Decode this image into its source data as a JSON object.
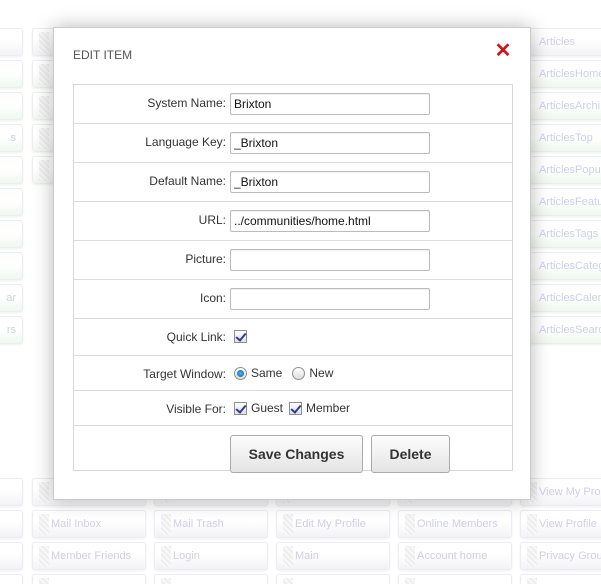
{
  "background": {
    "left_fragments": [
      "",
      "",
      "",
      "s",
      "",
      "",
      "",
      "",
      "ar",
      "rs"
    ],
    "right_column": [
      "Articles",
      "ArticlesHome",
      "ArticlesArchi",
      "ArticlesTop",
      "ArticlesPopul",
      "ArticlesFeatu",
      "ArticlesTags",
      "ArticlesCateg",
      "ArticlesCalen",
      "ArticlesSearc"
    ],
    "bottom_rows": [
      [
        "",
        "",
        "",
        "",
        "",
        "View My Pro"
      ],
      [
        "",
        "Mail Inbox",
        "Mail Trash",
        "Edit My Profile",
        "Online Members",
        "View Profile"
      ],
      [
        "",
        "Member Friends",
        "Login",
        "Main",
        "Account home",
        "Privacy Grou"
      ]
    ]
  },
  "dialog": {
    "title": "EDIT ITEM",
    "close_icon": "close-x-icon",
    "accent_close": "#d21414",
    "fields": {
      "system_name": {
        "label": "System Name:",
        "value": "Brixton"
      },
      "language_key": {
        "label": "Language Key:",
        "value": "_Brixton"
      },
      "default_name": {
        "label": "Default Name:",
        "value": "_Brixton"
      },
      "url": {
        "label": "URL:",
        "value": "../communities/home.html"
      },
      "picture": {
        "label": "Picture:",
        "value": ""
      },
      "icon": {
        "label": "Icon:",
        "value": ""
      }
    },
    "quick_link": {
      "label": "Quick Link:",
      "checked": true
    },
    "target_window": {
      "label": "Target Window:",
      "options": [
        "Same",
        "New"
      ],
      "selected": "Same"
    },
    "visible_for": {
      "label": "Visible For:",
      "guest": "Guest",
      "member": "Member"
    },
    "buttons": {
      "save": "Save Changes",
      "delete": "Delete"
    }
  }
}
